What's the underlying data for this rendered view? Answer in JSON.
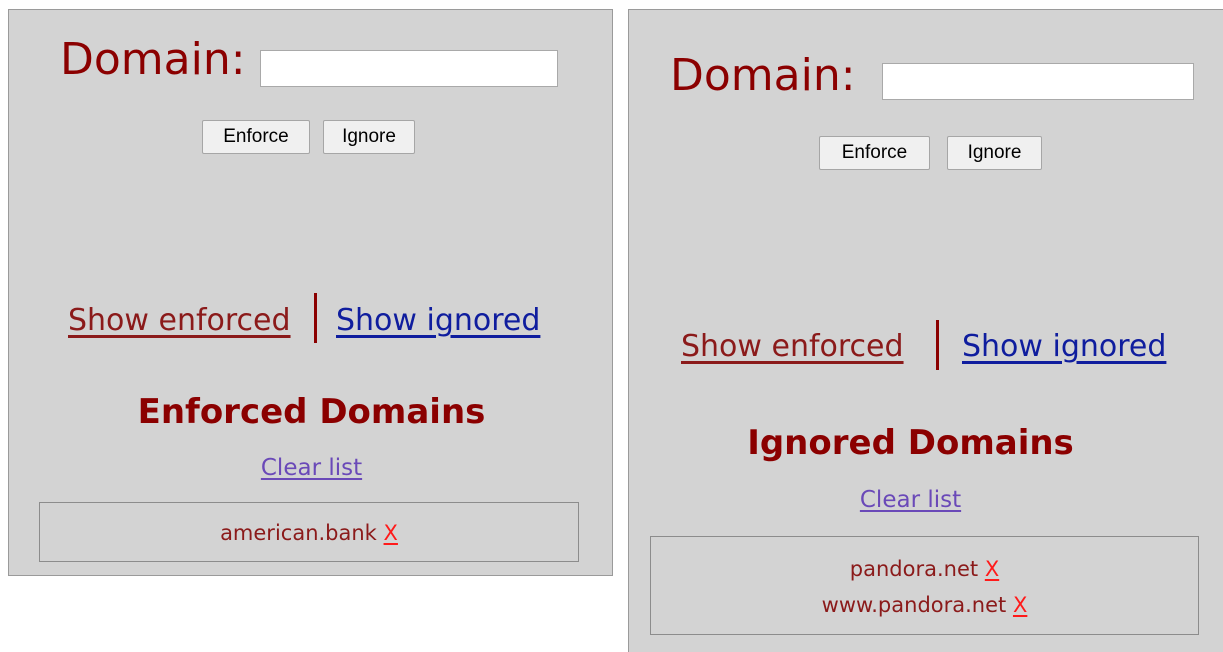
{
  "left_panel": {
    "domain_label": "Domain:",
    "domain_value": "",
    "enforce_label": "Enforce",
    "ignore_label": "Ignore",
    "show_enforced_label": "Show enforced",
    "show_ignored_label": "Show ignored",
    "heading": "Enforced Domains",
    "clear_label": "Clear list",
    "items": [
      {
        "domain": "american.bank",
        "remove": "X"
      }
    ]
  },
  "right_panel": {
    "domain_label": "Domain:",
    "domain_value": "",
    "enforce_label": "Enforce",
    "ignore_label": "Ignore",
    "show_enforced_label": "Show enforced",
    "show_ignored_label": "Show ignored",
    "heading": "Ignored Domains",
    "clear_label": "Clear list",
    "items": [
      {
        "domain": "pandora.net",
        "remove": "X"
      },
      {
        "domain": "www.pandora.net",
        "remove": "X"
      }
    ]
  },
  "colors": {
    "panel_background": "#d3d3d3",
    "label_dark_red": "#8b0000",
    "ignored_link_blue": "#0f1d9e",
    "clear_link_purple": "#6a49b8",
    "remove_red": "#ff1a1a"
  }
}
